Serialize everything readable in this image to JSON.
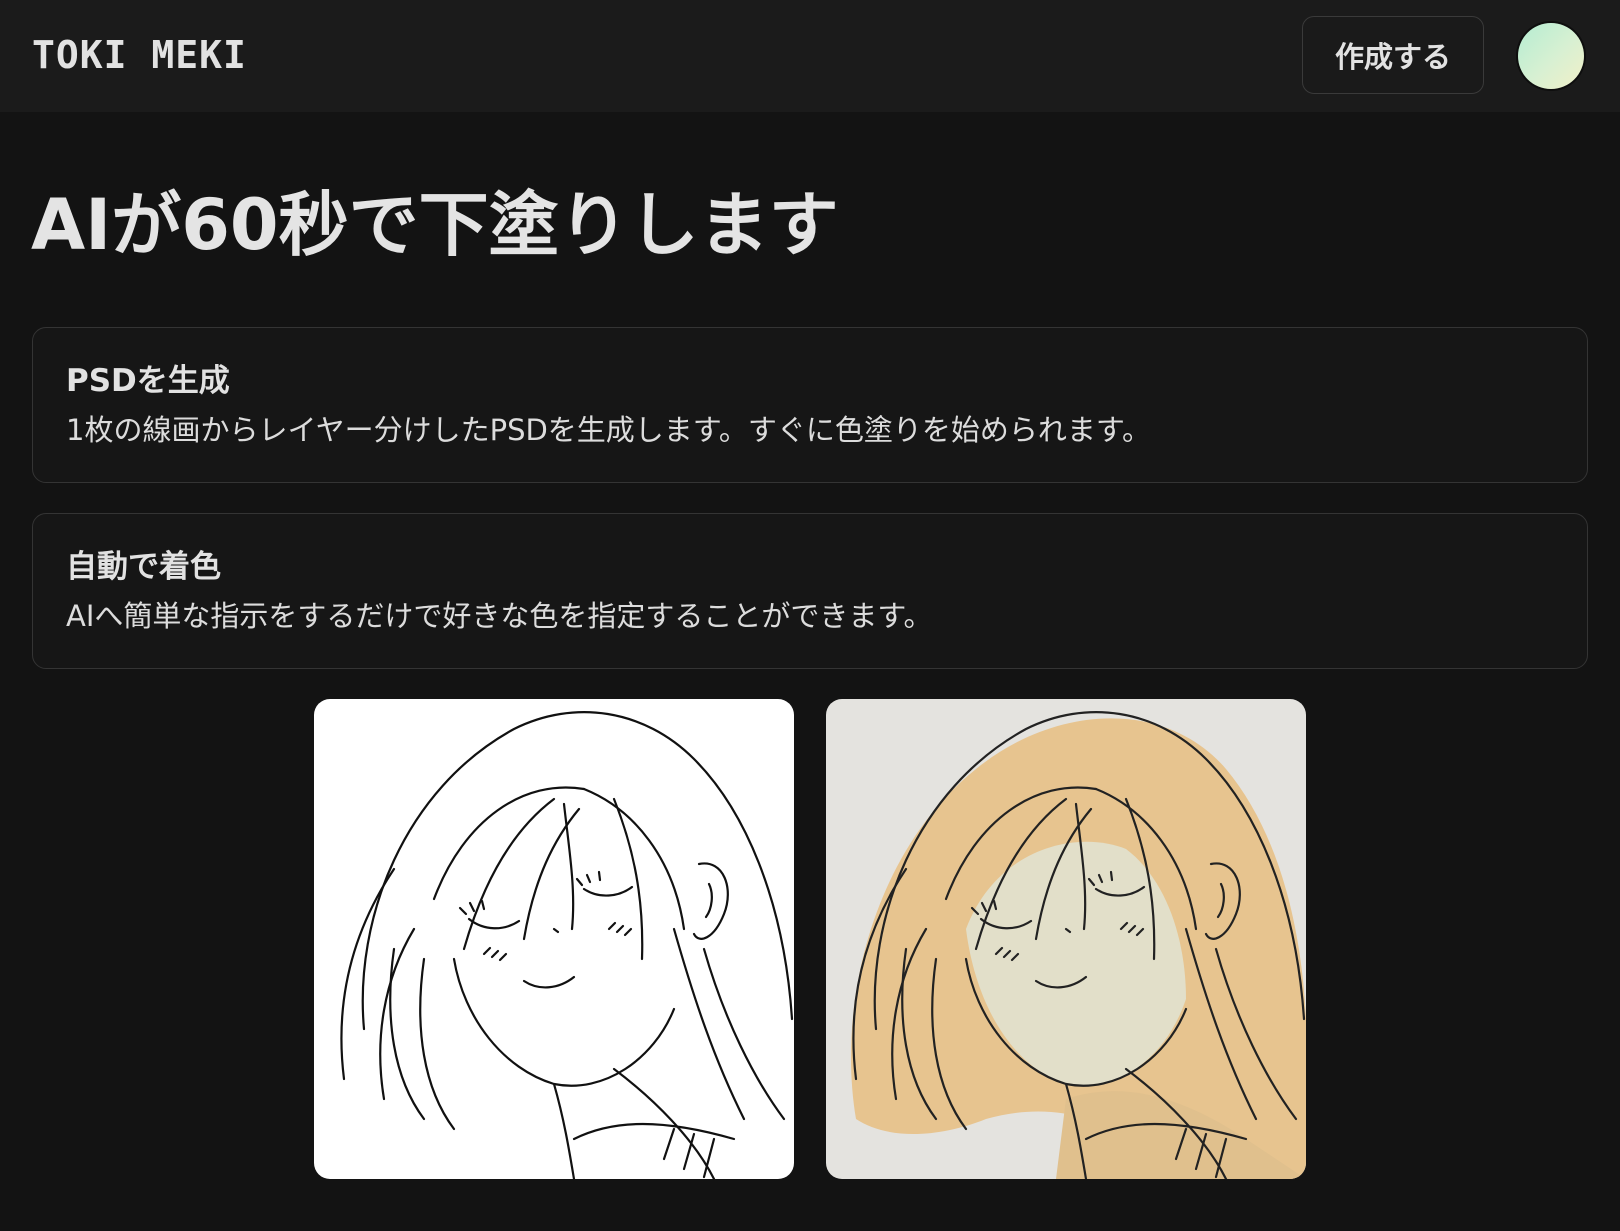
{
  "header": {
    "logo": "TOKI MEKI",
    "create_button": "作成する",
    "avatar_gradient": [
      "#b4edd2",
      "#f2f0c8"
    ]
  },
  "main": {
    "title": "AIが60秒で下塗りします",
    "features": [
      {
        "title": "PSDを生成",
        "description": "1枚の線画からレイヤー分けしたPSDを生成します。すぐに色塗りを始められます。"
      },
      {
        "title": "自動で着色",
        "description": "AIへ簡単な指示をするだけで好きな色を指定することができます。"
      }
    ],
    "images": {
      "line_art_bg": "#ffffff",
      "colored_bg": "#e4e3df",
      "hair_color": "#e7c48f",
      "skin_color": "#e2dfc9"
    }
  }
}
